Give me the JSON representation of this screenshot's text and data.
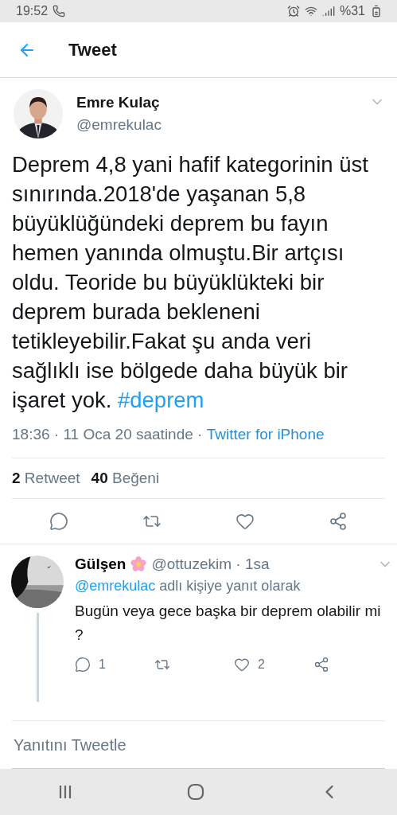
{
  "status_bar": {
    "time": "19:52",
    "battery": "%31"
  },
  "header": {
    "title": "Tweet"
  },
  "tweet": {
    "author": "Emre Kulaç",
    "handle": "@emrekulac",
    "text": "Deprem 4,8 yani hafif kategorinin üst sınırında.2018'de yaşanan 5,8 büyüklüğündeki deprem bu fayın hemen yanında olmuştu.Bir artçısı oldu. Teoride bu büyüklükteki bir deprem burada bekleneni tetikleyebilir.Fakat şu anda veri sağlıklı ise bölgede daha büyük bir işaret yok.",
    "hashtag": "#deprem",
    "timestamp": "18:36 · 11 Oca 20 saatinde · ",
    "source": "Twitter for iPhone",
    "stats": [
      {
        "count": "2",
        "label": "Retweet"
      },
      {
        "count": "40",
        "label": "Beğeni"
      }
    ]
  },
  "reply": {
    "author": "Gülşen",
    "handle": "@ottuzekim · 1sa",
    "mention": "@emrekulac",
    "reply_note": " adlı kişiye yanıt olarak",
    "text": "Bugün veya gece başka bir deprem olabilir mi ?",
    "actions": [
      {
        "kind": "reply",
        "count": "1"
      },
      {
        "kind": "retweet"
      },
      {
        "kind": "like",
        "count": "2"
      },
      {
        "kind": "share"
      }
    ]
  },
  "composer": {
    "placeholder": "Yanıtını Tweetle"
  }
}
